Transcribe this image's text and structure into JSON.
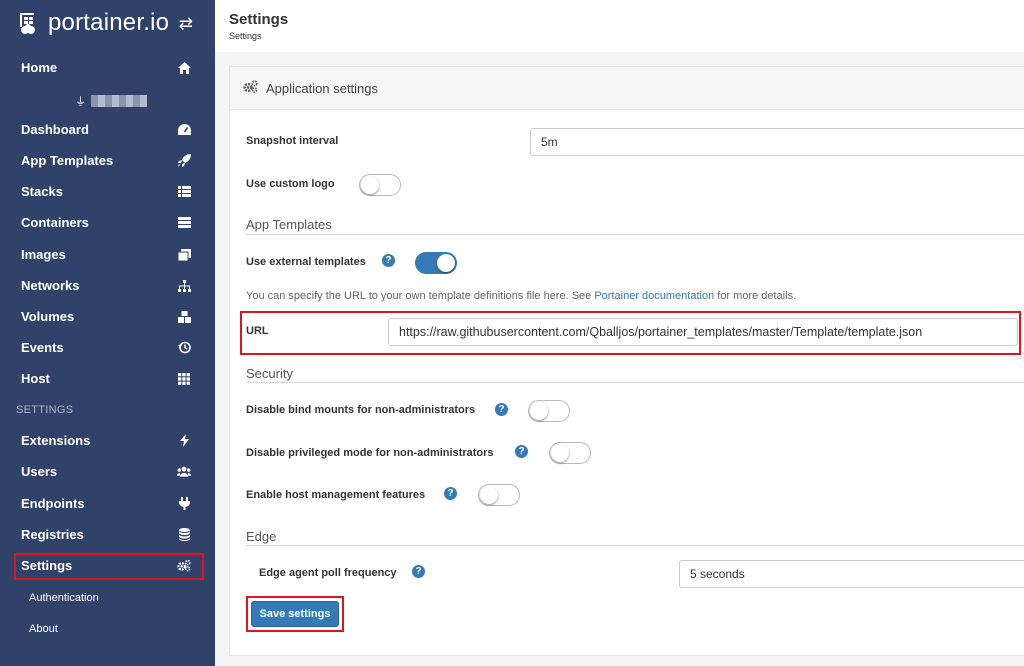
{
  "sidebar": {
    "brand": "portainer.io",
    "home": "Home",
    "items": [
      {
        "label": "Dashboard",
        "icon": "dashboard-icon"
      },
      {
        "label": "App Templates",
        "icon": "rocket-icon"
      },
      {
        "label": "Stacks",
        "icon": "list-icon"
      },
      {
        "label": "Containers",
        "icon": "server-icon"
      },
      {
        "label": "Images",
        "icon": "clone-icon"
      },
      {
        "label": "Networks",
        "icon": "sitemap-icon"
      },
      {
        "label": "Volumes",
        "icon": "cubes-icon"
      },
      {
        "label": "Events",
        "icon": "history-icon"
      },
      {
        "label": "Host",
        "icon": "grid-icon"
      }
    ],
    "settings_header": "SETTINGS",
    "settings_items": [
      {
        "label": "Extensions",
        "icon": "bolt-icon"
      },
      {
        "label": "Users",
        "icon": "users-icon"
      },
      {
        "label": "Endpoints",
        "icon": "plug-icon"
      },
      {
        "label": "Registries",
        "icon": "database-icon"
      },
      {
        "label": "Settings",
        "icon": "cogs-icon"
      }
    ],
    "sub_items": [
      "Authentication",
      "About"
    ]
  },
  "header": {
    "title": "Settings",
    "breadcrumb": "Settings"
  },
  "panel": {
    "title": "Application settings",
    "snapshot_label": "Snapshot interval",
    "snapshot_value": "5m",
    "custom_logo_label": "Use custom logo",
    "app_templates_section": "App Templates",
    "external_templates_label": "Use external templates",
    "help_prefix": "You can specify the URL to your own template definitions file here. See ",
    "help_link": "Portainer documentation",
    "help_suffix": " for more details.",
    "url_label": "URL",
    "url_value": "https://raw.githubusercontent.com/Qballjos/portainer_templates/master/Template/template.json",
    "security_section": "Security",
    "bind_mounts_label": "Disable bind mounts for non-administrators",
    "privileged_label": "Disable privileged mode for non-administrators",
    "host_mgmt_label": "Enable host management features",
    "edge_section": "Edge",
    "edge_poll_label": "Edge agent poll frequency",
    "edge_poll_value": "5 seconds",
    "save_button": "Save settings"
  },
  "colors": {
    "sidebar_bg": "#30426a",
    "primary": "#337ab7",
    "highlight": "#e0141e"
  }
}
